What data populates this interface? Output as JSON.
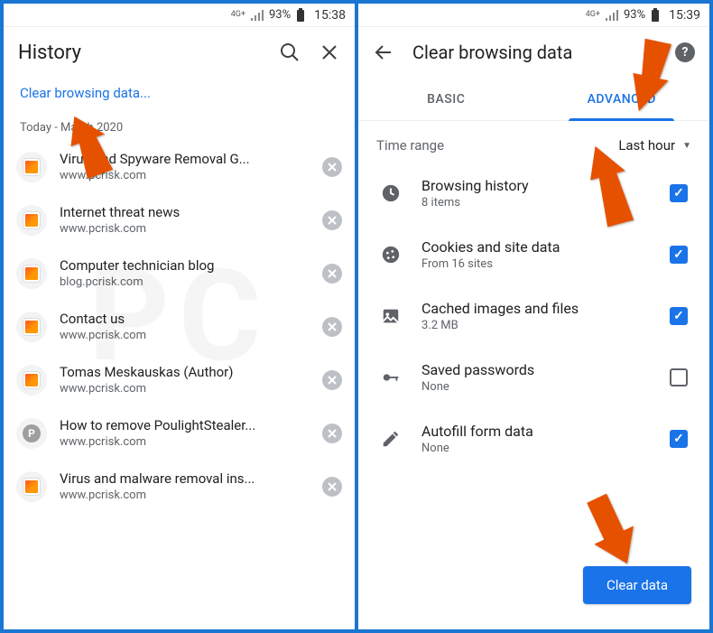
{
  "left": {
    "status": {
      "net": "4G+",
      "battery_pct": "93%",
      "clock": "15:38"
    },
    "title": "History",
    "clear_link": "Clear browsing data...",
    "section_label": "Today - March 2020",
    "items": [
      {
        "title": "Virus and Spyware Removal G...",
        "domain": "www.pcrisk.com",
        "fav": "pcrisk"
      },
      {
        "title": "Internet threat news",
        "domain": "www.pcrisk.com",
        "fav": "pcrisk"
      },
      {
        "title": "Computer technician blog",
        "domain": "blog.pcrisk.com",
        "fav": "pcrisk"
      },
      {
        "title": "Contact us",
        "domain": "www.pcrisk.com",
        "fav": "pcrisk"
      },
      {
        "title": "Tomas Meskauskas (Author)",
        "domain": "www.pcrisk.com",
        "fav": "pcrisk"
      },
      {
        "title": "How to remove PoulightStealer...",
        "domain": "www.pcrisk.com",
        "fav": "p"
      },
      {
        "title": "Virus and malware removal ins...",
        "domain": "www.pcrisk.com",
        "fav": "pcrisk"
      }
    ]
  },
  "right": {
    "status": {
      "net": "4G+",
      "battery_pct": "93%",
      "clock": "15:39"
    },
    "title": "Clear browsing data",
    "tabs": {
      "basic": "BASIC",
      "advanced": "ADVANCED",
      "active": "advanced"
    },
    "time_range": {
      "label": "Time range",
      "value": "Last hour"
    },
    "options": [
      {
        "icon": "clock",
        "title": "Browsing history",
        "sub": "8 items",
        "checked": true
      },
      {
        "icon": "cookie",
        "title": "Cookies and site data",
        "sub": "From 16 sites",
        "checked": true
      },
      {
        "icon": "image",
        "title": "Cached images and files",
        "sub": "3.2 MB",
        "checked": true
      },
      {
        "icon": "key",
        "title": "Saved passwords",
        "sub": "None",
        "checked": false
      },
      {
        "icon": "pencil",
        "title": "Autofill form data",
        "sub": "None",
        "checked": true
      }
    ],
    "clear_button": "Clear data"
  },
  "colors": {
    "accent": "#1a73e8",
    "arrow": "#e65100"
  }
}
